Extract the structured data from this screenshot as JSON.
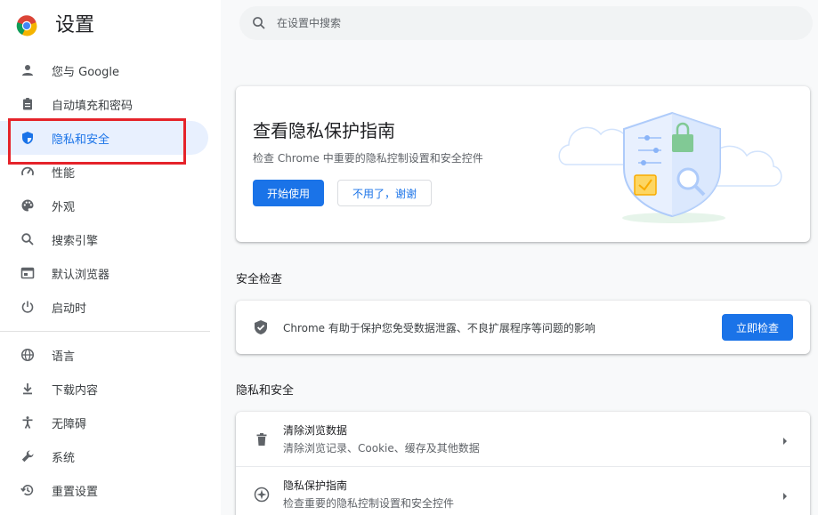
{
  "app": {
    "title": "设置"
  },
  "search": {
    "placeholder": "在设置中搜索"
  },
  "sidebar": {
    "group1": [
      {
        "label": "您与 Google",
        "icon": "person-icon"
      },
      {
        "label": "自动填充和密码",
        "icon": "clipboard-icon"
      },
      {
        "label": "隐私和安全",
        "icon": "shield-icon",
        "active": true
      },
      {
        "label": "性能",
        "icon": "speedometer-icon"
      },
      {
        "label": "外观",
        "icon": "palette-icon"
      },
      {
        "label": "搜索引擎",
        "icon": "search-icon"
      },
      {
        "label": "默认浏览器",
        "icon": "browser-window-icon"
      },
      {
        "label": "启动时",
        "icon": "power-icon"
      }
    ],
    "group2": [
      {
        "label": "语言",
        "icon": "globe-icon"
      },
      {
        "label": "下载内容",
        "icon": "download-icon"
      },
      {
        "label": "无障碍",
        "icon": "accessibility-icon"
      },
      {
        "label": "系统",
        "icon": "wrench-icon"
      },
      {
        "label": "重置设置",
        "icon": "reset-icon"
      }
    ]
  },
  "guide_card": {
    "title": "查看隐私保护指南",
    "description": "检查 Chrome 中重要的隐私控制设置和安全控件",
    "start_label": "开始使用",
    "no_thanks_label": "不用了，谢谢"
  },
  "safety_check": {
    "section_title": "安全检查",
    "text": "Chrome 有助于保护您免受数据泄露、不良扩展程序等问题的影响",
    "button_label": "立即检查"
  },
  "privacy_section": {
    "section_title": "隐私和安全",
    "rows": [
      {
        "title": "清除浏览数据",
        "subtitle": "清除浏览记录、Cookie、缓存及其他数据",
        "icon": "trash-icon"
      },
      {
        "title": "隐私保护指南",
        "subtitle": "检查重要的隐私控制设置和安全控件",
        "icon": "compass-icon"
      }
    ]
  },
  "colors": {
    "accent": "#1a73e8",
    "active_bg": "#e8f0fe",
    "highlight_border": "#e5232a",
    "page_bg": "#f8f9fa"
  }
}
